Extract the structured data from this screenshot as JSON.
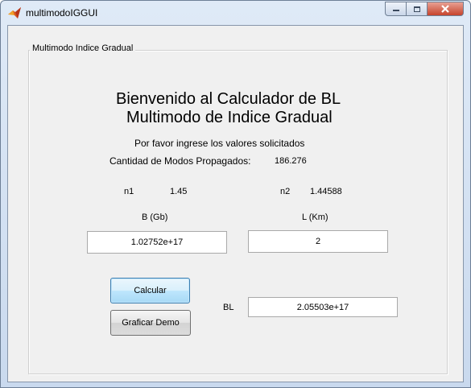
{
  "window": {
    "title": "multimodoIGGUI",
    "icon": "matlab-icon",
    "controls": [
      "minimize-icon",
      "maximize-icon",
      "close-icon"
    ]
  },
  "panel": {
    "title": "Multimodo Indice Gradual",
    "heading_line1": "Bienvenido al Calculador de BL",
    "heading_line2": "Multimodo de Indice Gradual",
    "prompt": "Por favor ingrese los valores solicitados",
    "modes_label": "Cantidad de Modos Propagados:",
    "modes_value": "186.276",
    "n1_label": "n1",
    "n1_value": "1.45",
    "n2_label": "n2",
    "n2_value": "1.44588",
    "b_label": "B (Gb)",
    "b_value": "1.02752e+17",
    "l_label": "L (Km)",
    "l_value": "2",
    "calcular_label": "Calcular",
    "graficar_label": "Graficar Demo",
    "bl_label": "BL",
    "bl_value": "2.05503e+17"
  }
}
